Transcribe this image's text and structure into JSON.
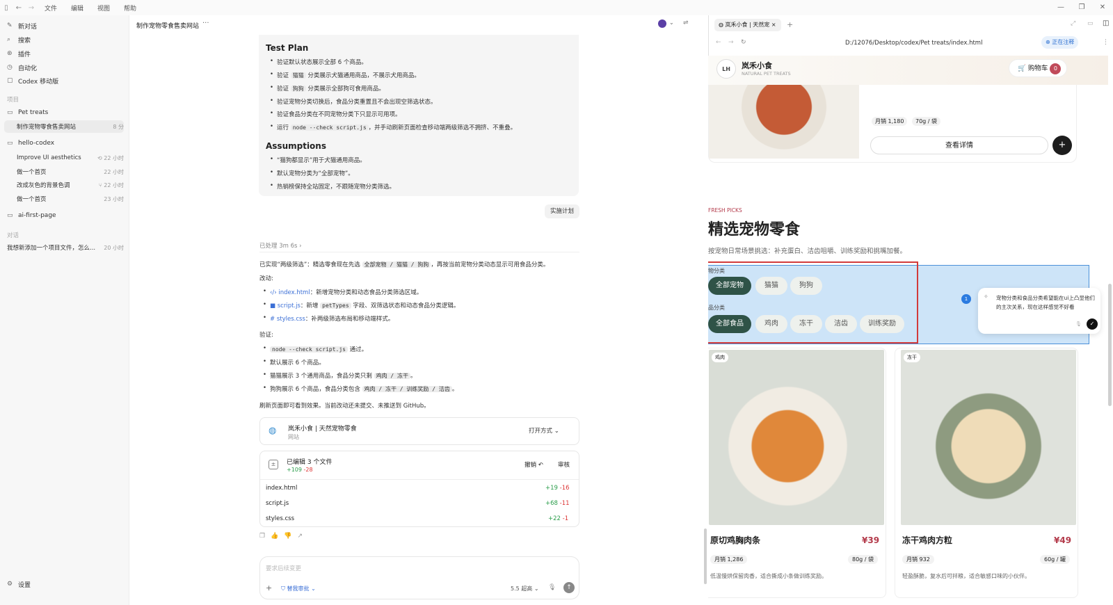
{
  "titlebar": {
    "menus": [
      "文件",
      "编辑",
      "视图",
      "帮助"
    ]
  },
  "sidebar": {
    "top": [
      "新对话",
      "搜索",
      "插件",
      "自动化",
      "Codex 移动版"
    ],
    "projects_label": "项目",
    "projects": [
      {
        "name": "Pet treats",
        "threads": [
          {
            "title": "制作宠物零食售卖网站",
            "time": "8 分"
          }
        ]
      },
      {
        "name": "hello-codex",
        "threads": [
          {
            "title": "Improve UI aesthetics",
            "time": "22 小时"
          },
          {
            "title": "做一个首页",
            "time": "22 小时"
          },
          {
            "title": "改成灰色的背景色调",
            "time": "22 小时"
          },
          {
            "title": "做一个首页",
            "time": "23 小时"
          }
        ]
      },
      {
        "name": "ai-first-page",
        "threads": []
      }
    ],
    "chats_label": "对话",
    "chats": [
      {
        "title": "我想新添加一个项目文件，怎么...",
        "time": "20 小时"
      }
    ],
    "settings": "设置"
  },
  "chat": {
    "title": "制作宠物零食售卖网站",
    "plan": {
      "test_title": "Test Plan",
      "test_items": [
        "验证默认状态展示全部 6 个商品。",
        [
          "验证 ",
          "猫猫",
          " 分类展示犬猫通用商品，不展示犬用商品。"
        ],
        [
          "验证 ",
          "狗狗",
          " 分类展示全部狗可食用商品。"
        ],
        "验证宠物分类切换后，食品分类重置且不会出现空筛选状态。",
        "验证食品分类在不同宠物分类下只显示可用项。",
        [
          "运行 ",
          "node --check script.js",
          "，并手动刷新页面检查移动端两级筛选不拥挤、不重叠。"
        ]
      ],
      "assump_title": "Assumptions",
      "assump_items": [
        "“猫狗都显示”用于犬猫通用商品。",
        "默认宠物分类为“全部宠物”。",
        "热销榜保持全站固定，不跟随宠物分类筛选。"
      ]
    },
    "implement_btn": "实施计划",
    "processed": "已处理 3m 6s",
    "summary": [
      "已实现“两级筛选”：精选零食现在先选 ",
      "全部宠物 / 猫猫 / 狗狗",
      "，再按当前宠物分类动态显示可用食品分类。"
    ],
    "changes_label": "改动:",
    "changes": [
      {
        "icon": "‹/›",
        "file": "index.html",
        "text": "：新增宠物分类和动态食品分类筛选区域。"
      },
      {
        "icon": "■",
        "file": "script.js",
        "pre": "：新增 ",
        "code": "petTypes",
        "text": " 字段、双筛选状态和动态食品分类逻辑。"
      },
      {
        "icon": "#",
        "file": "styles.css",
        "text": "：补两级筛选布局和移动端样式。"
      }
    ],
    "verify_label": "验证:",
    "verify": [
      [
        "",
        "node --check script.js",
        " 通过。"
      ],
      "默认展示 6 个商品。",
      [
        "猫猫展示 3 个通用商品，食品分类只剩 ",
        "鸡肉 / 冻干",
        "。"
      ],
      [
        "狗狗展示 6 个商品，食品分类包含 ",
        "鸡肉 / 冻干 / 训练奖励 / 洁齿",
        "。"
      ]
    ],
    "refresh_note": "刷新页面即可看到效果。当前改动还未提交、未推送到 GitHub。",
    "site_card": {
      "title": "岚禾小食 | 天然宠物零食",
      "sub": "网站",
      "open": "打开方式"
    },
    "files_card": {
      "title": "已编辑 3 个文件",
      "add": "+109",
      "del": "-28",
      "undo": "撤销",
      "review": "审核",
      "files": [
        {
          "name": "index.html",
          "add": "+19",
          "del": "-16"
        },
        {
          "name": "script.js",
          "add": "+68",
          "del": "-11"
        },
        {
          "name": "styles.css",
          "add": "+22",
          "del": "-1"
        }
      ]
    },
    "input_placeholder": "要求后续变更",
    "mode": "替我审批",
    "model": "5.5",
    "reasoning": "超高"
  },
  "browser": {
    "tab_title": "岚禾小食 | 天然宠",
    "url": "D:/12076/Desktop/codex/Pet treats/index.html",
    "annotating": "正在注释",
    "shop": {
      "logo": "LH",
      "name": "岚禾小食",
      "tagline": "NATURAL PET TREATS",
      "cart": "购物车",
      "cart_count": "0",
      "top_card": {
        "sales": "月销 1,180",
        "weight": "70g / 袋",
        "detail": "查看详情"
      },
      "eyebrow": "FRESH PICKS",
      "heading": "精选宠物零食",
      "subheading": "按宠物日常场景挑选：补充蛋白、洁齿咀嚼、训练奖励和挑嘴加餐。",
      "pet_label": "宠物分类",
      "pets": [
        "全部宠物",
        "猫猫",
        "狗狗"
      ],
      "food_label": "食品分类",
      "foods": [
        "全部食品",
        "鸡肉",
        "冻干",
        "洁齿",
        "训练奖励"
      ],
      "comment": {
        "num": "1",
        "text": "宠物分类和食品分类希望能在ui上凸显他们的主次关系，现在这样感觉不好看"
      },
      "products": [
        {
          "tag": "鸡肉",
          "name": "原切鸡胸肉条",
          "price": "¥39",
          "sales": "月销 1,286",
          "weight": "80g / 袋",
          "desc": "低温慢烘保留肉香，适合撕成小条做训练奖励。"
        },
        {
          "tag": "冻干",
          "name": "冻干鸡肉方粒",
          "price": "¥49",
          "sales": "月销 932",
          "weight": "60g / 罐",
          "desc": "轻盈酥脆，复水后可拌粮，适合敏感口味的小伙伴。"
        }
      ]
    }
  }
}
